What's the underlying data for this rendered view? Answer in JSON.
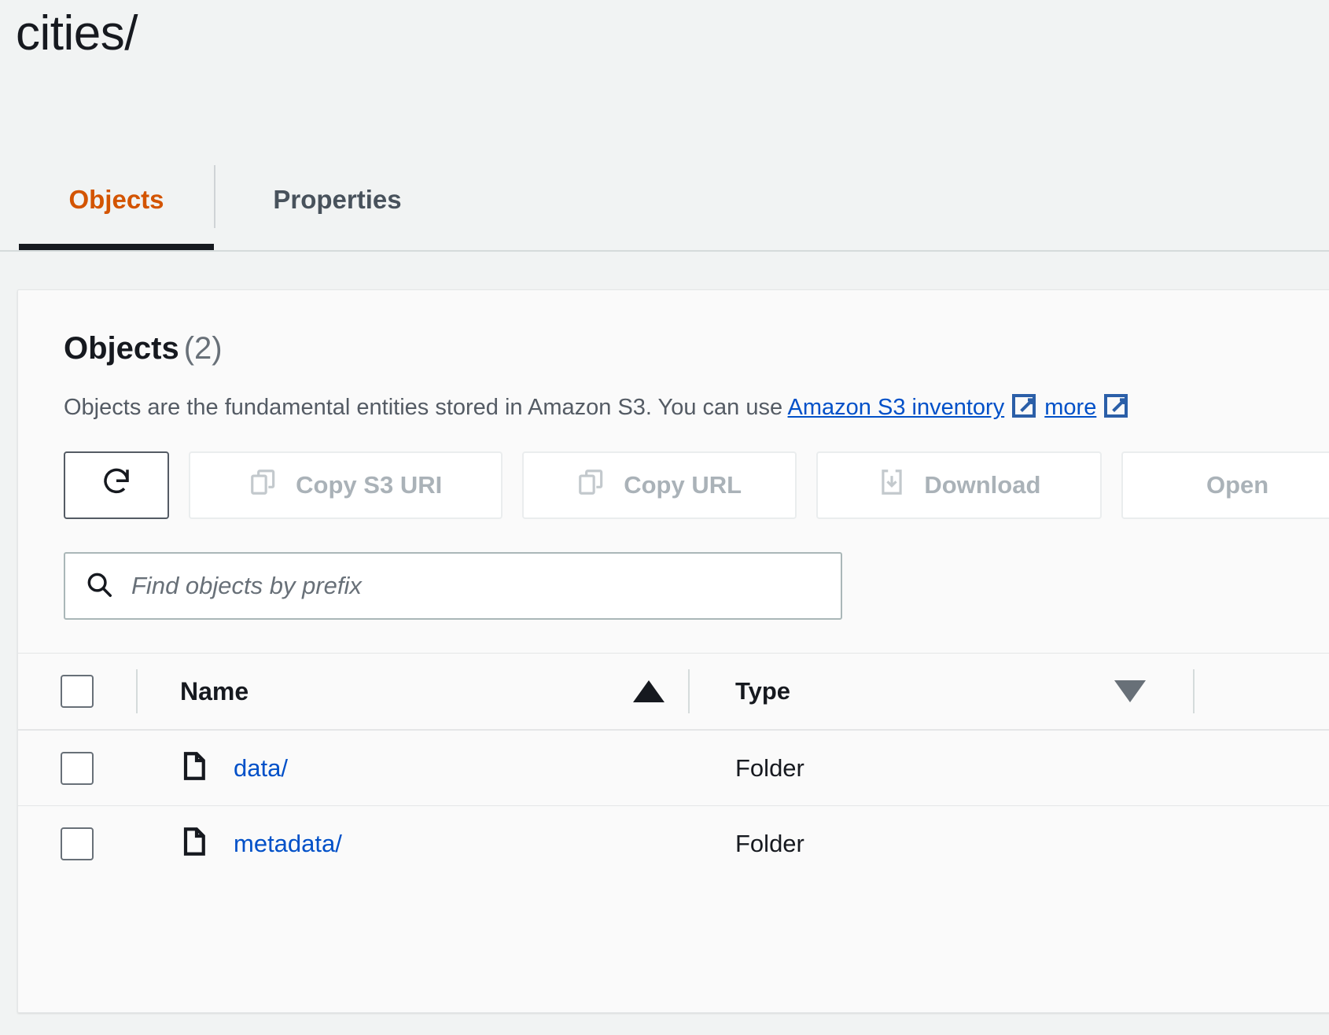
{
  "page": {
    "title": "cities/"
  },
  "tabs": [
    {
      "label": "Objects",
      "active": true
    },
    {
      "label": "Properties",
      "active": false
    }
  ],
  "panel": {
    "heading": "Objects",
    "count": "(2)",
    "description_part1": "Objects are the fundamental entities stored in Amazon S3. You can use ",
    "description_link1": "Amazon S3 inventory",
    "description_part2": " ",
    "description_link2": "more",
    "buttons": [
      {
        "label": "",
        "name": "refresh-button",
        "icon": "refresh-icon",
        "disabled": false
      },
      {
        "label": "Copy S3 URI",
        "name": "copy-s3-uri-button",
        "icon": "copy-icon",
        "disabled": true
      },
      {
        "label": "Copy URL",
        "name": "copy-url-button",
        "icon": "copy-icon",
        "disabled": true
      },
      {
        "label": "Download",
        "name": "download-button",
        "icon": "download-icon",
        "disabled": true
      },
      {
        "label": "Open",
        "name": "open-button",
        "icon": "external-link-icon",
        "disabled": true
      }
    ],
    "search": {
      "placeholder": "Find objects by prefix",
      "value": ""
    },
    "table": {
      "columns": [
        {
          "label": "Name",
          "sort": "asc"
        },
        {
          "label": "Type",
          "sort": "none"
        }
      ],
      "rows": [
        {
          "name": "data/",
          "type": "Folder",
          "icon": "folder-icon"
        },
        {
          "name": "metadata/",
          "type": "Folder",
          "icon": "folder-icon"
        }
      ]
    }
  },
  "colors": {
    "active_tab": "#d35400",
    "link": "#0050c8",
    "page_background": "#f1f3f3",
    "card_background": "#fafafa",
    "disabled_text": "#aab2b8"
  }
}
